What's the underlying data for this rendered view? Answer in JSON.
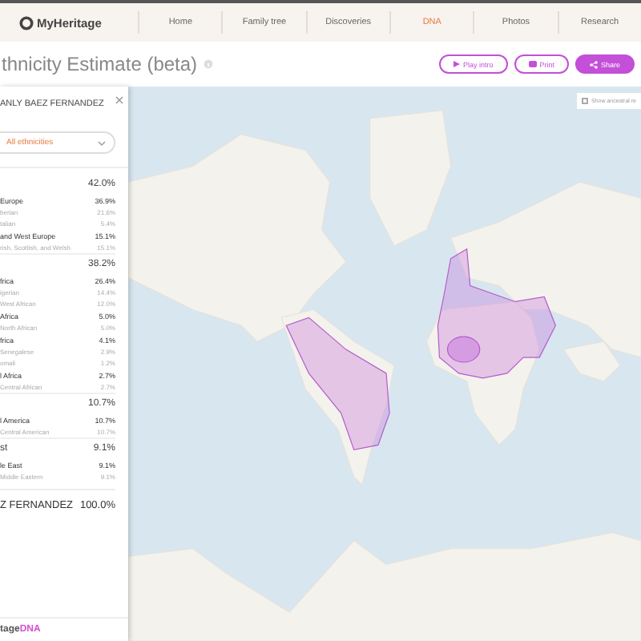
{
  "nav": {
    "logo": "MyHeritage",
    "items": [
      {
        "label": "Home",
        "selected": false
      },
      {
        "label": "Family tree",
        "selected": false
      },
      {
        "label": "Discoveries",
        "selected": false
      },
      {
        "label": "DNA",
        "selected": true
      },
      {
        "label": "Photos",
        "selected": false
      },
      {
        "label": "Research",
        "selected": false
      }
    ]
  },
  "page": {
    "title": "thnicity Estimate (beta)",
    "buttons": [
      {
        "label": "Play intro",
        "kind": "play"
      },
      {
        "label": "Print",
        "kind": "print"
      },
      {
        "label": "Share",
        "kind": "share"
      }
    ]
  },
  "sidebar": {
    "name": "ANLY BAEZ FERNANDEZ",
    "dropdown": "All ethnicities",
    "rows": [
      {
        "kind": "total",
        "label": "",
        "value": "42.0%"
      },
      {
        "kind": "region",
        "label": "Europe",
        "value": "36.9%"
      },
      {
        "kind": "sub",
        "label": "berian",
        "value": "21.6%"
      },
      {
        "kind": "sub",
        "label": "talian",
        "value": "5.4%"
      },
      {
        "kind": "region",
        "label": "and West Europe",
        "value": "15.1%"
      },
      {
        "kind": "sub",
        "label": "rish, Scottish, and Welsh",
        "value": "15.1%"
      },
      {
        "kind": "total",
        "label": "",
        "value": "38.2%"
      },
      {
        "kind": "region",
        "label": "frica",
        "value": "26.4%"
      },
      {
        "kind": "sub",
        "label": "igerian",
        "value": "14.4%"
      },
      {
        "kind": "sub",
        "label": "West African",
        "value": "12.0%"
      },
      {
        "kind": "region",
        "label": "Africa",
        "value": "5.0%"
      },
      {
        "kind": "sub",
        "label": "North African",
        "value": "5.0%"
      },
      {
        "kind": "region",
        "label": "frica",
        "value": "4.1%"
      },
      {
        "kind": "sub",
        "label": "Senegalese",
        "value": "2.9%"
      },
      {
        "kind": "sub",
        "label": "omali",
        "value": "1.2%"
      },
      {
        "kind": "region",
        "label": "l Africa",
        "value": "2.7%"
      },
      {
        "kind": "sub",
        "label": "Central African",
        "value": "2.7%"
      },
      {
        "kind": "total",
        "label": "",
        "value": "10.7%"
      },
      {
        "kind": "region",
        "label": "l America",
        "value": "10.7%"
      },
      {
        "kind": "sub",
        "label": "Central American",
        "value": "10.7%"
      },
      {
        "kind": "total",
        "label": "st",
        "value": "9.1%"
      },
      {
        "kind": "region",
        "label": "le East",
        "value": "9.1%"
      },
      {
        "kind": "sub",
        "label": "Middle Eastern",
        "value": "9.1%"
      },
      {
        "kind": "grand",
        "label": "Z FERNANDEZ",
        "value": "100.0%"
      }
    ],
    "footer": {
      "brand": "tage",
      "accent": "DNA"
    }
  },
  "map": {
    "toggle": {
      "label": "Show ancestral re",
      "checked": false
    }
  }
}
